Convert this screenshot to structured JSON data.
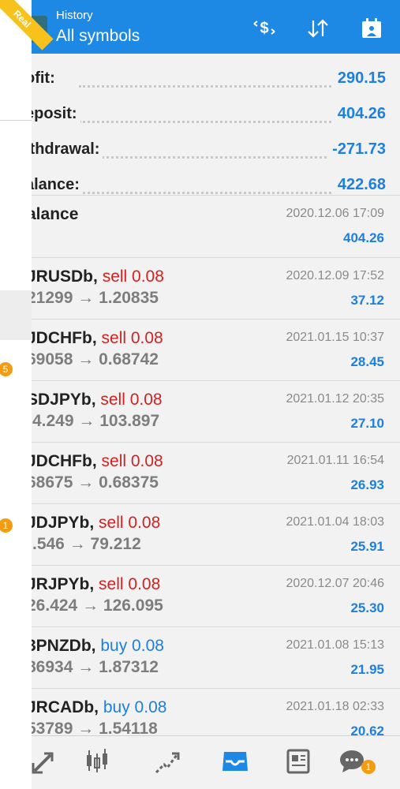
{
  "header": {
    "title": "History",
    "subtitle": "All symbols",
    "ribbon": "Real"
  },
  "drawer": {
    "badges": [
      "5",
      "1"
    ]
  },
  "summary": [
    {
      "label": "ofit:",
      "value": "290.15"
    },
    {
      "label": "eposit:",
      "value": "404.26"
    },
    {
      "label": "ithdrawal:",
      "value": "-271.73"
    },
    {
      "label": "alance:",
      "value": "422.68"
    }
  ],
  "balance_entry": {
    "label": "alance",
    "time": "2020.12.06 17:09",
    "amount": "404.26"
  },
  "deals": [
    {
      "symbol": "JRUSDb,",
      "direction": "sell 0.08",
      "side": "sell",
      "prices": "21299 → 1.20835",
      "time": "2020.12.09 17:52",
      "profit": "37.12"
    },
    {
      "symbol": "JDCHFb,",
      "direction": "sell 0.08",
      "side": "sell",
      "prices": "69058 → 0.68742",
      "time": "2021.01.15 10:37",
      "profit": "28.45"
    },
    {
      "symbol": "SDJPYb,",
      "direction": "sell 0.08",
      "side": "sell",
      "prices": ")4.249 → 103.897",
      "time": "2021.01.12 20:35",
      "profit": "27.10"
    },
    {
      "symbol": "JDCHFb,",
      "direction": "sell 0.08",
      "side": "sell",
      "prices": "68675 → 0.68375",
      "time": "2021.01.11 16:54",
      "profit": "26.93"
    },
    {
      "symbol": "JDJPYb,",
      "direction": "sell 0.08",
      "side": "sell",
      "prices": ").546 → 79.212",
      "time": "2021.01.04 18:03",
      "profit": "25.91"
    },
    {
      "symbol": "JRJPYb,",
      "direction": "sell 0.08",
      "side": "sell",
      "prices": "26.424 → 126.095",
      "time": "2020.12.07 20:46",
      "profit": "25.30"
    },
    {
      "symbol": "3PNZDb,",
      "direction": "buy 0.08",
      "side": "buy",
      "prices": "86934 → 1.87312",
      "time": "2021.01.08 15:13",
      "profit": "21.95"
    },
    {
      "symbol": "JRCADb,",
      "direction": "buy 0.08",
      "side": "buy",
      "prices": "53789 → 1.54118",
      "time": "2021.01.18 02:33",
      "profit": "20.62"
    }
  ],
  "bottomnav": {
    "chat_badge": "1"
  },
  "colors": {
    "accent": "#1e88e5",
    "sell": "#d32020",
    "buy": "#1d7fe0",
    "badge": "#f39c12"
  }
}
